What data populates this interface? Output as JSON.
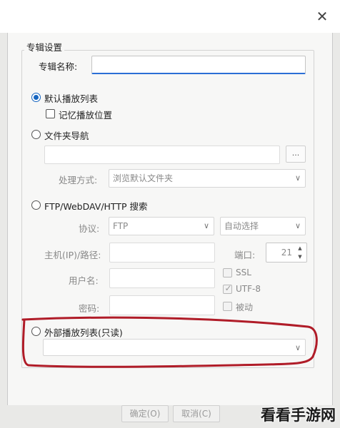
{
  "window": {
    "close_glyph": "✕"
  },
  "group": {
    "title": "专辑设置"
  },
  "album_name": {
    "label": "专辑名称:",
    "value": ""
  },
  "default_playlist": {
    "label": "默认播放列表",
    "selected": true
  },
  "remember_position": {
    "label": "记忆播放位置",
    "checked": false
  },
  "folder_nav": {
    "label": "文件夹导航",
    "path_value": "",
    "browse_label": "..."
  },
  "processing": {
    "label": "处理方式:",
    "value": "浏览默认文件夹"
  },
  "remote_search": {
    "label": "FTP/WebDAV/HTTP 搜索"
  },
  "protocol": {
    "label": "协议:",
    "value": "FTP",
    "encoding_value": "自动选择"
  },
  "host": {
    "label": "主机(IP)/路径:",
    "value": ""
  },
  "port": {
    "label": "端口:",
    "value": "21"
  },
  "username": {
    "label": "用户名:",
    "value": ""
  },
  "password": {
    "label": "密码:",
    "value": ""
  },
  "ssl": {
    "label": "SSL",
    "checked": false
  },
  "utf8": {
    "label": "UTF-8",
    "checked": true
  },
  "passive": {
    "label": "被动",
    "checked": false
  },
  "external_playlist": {
    "label": "外部播放列表(只读)",
    "value": ""
  },
  "footer": {
    "ok_label": "确定(O)",
    "cancel_label": "取消(C)"
  },
  "watermark": {
    "text": "看看手游网"
  },
  "icons": {
    "chevron": "∨",
    "spin_up": "▲",
    "spin_down": "▼"
  },
  "colors": {
    "accent": "#1565c0",
    "annotation": "#b01c28"
  }
}
